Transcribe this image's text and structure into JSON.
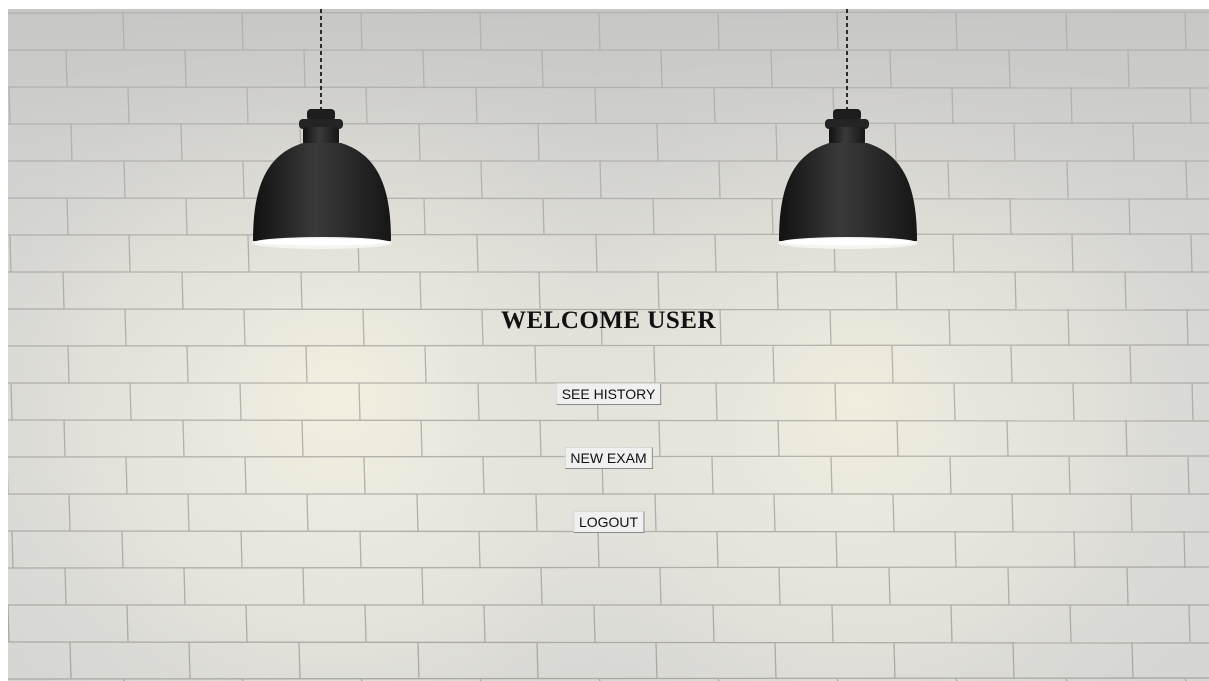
{
  "page": {
    "title": "WELCOME USER"
  },
  "buttons": {
    "see_history": "SEE HISTORY",
    "new_exam": "NEW EXAM",
    "logout": "LOGOUT"
  },
  "background": {
    "image": "white-brick-wall",
    "lamp_icon": "pendant-lamp-icon",
    "wall_color": "#d9d9d7",
    "glow_color": "#f6f2df",
    "lamp_color": "#1e1e1e"
  }
}
